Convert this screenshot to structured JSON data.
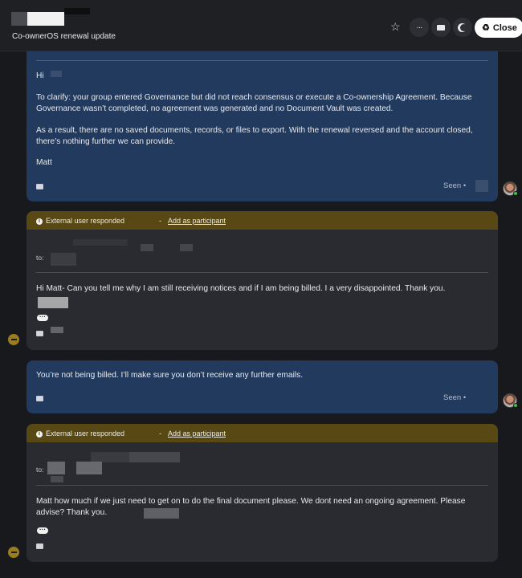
{
  "header": {
    "title": "Co-ownerOS renewal update",
    "close_label": "Close",
    "more_glyph": "···"
  },
  "messages": [
    {
      "greeting": "Hi",
      "paragraph1": "To clarify: your group entered Governance but did not reach consensus or execute a Co-ownership Agreement. Because Governance wasn’t completed, no agreement was generated and no Document Vault was created.",
      "paragraph2": "As a result, there are no saved documents, records, or files to export. With the renewal reversed and the account closed, there’s nothing further we can provide.",
      "signoff": "Matt",
      "seen_label": "Seen •"
    },
    {
      "banner_text": "External user responded",
      "banner_sep": "-",
      "banner_link": "Add as participant",
      "to_label": "to:",
      "body": "Hi Matt- Can you tell me why I am still receiving notices and if I am being billed. I a very disappointed. Thank you."
    },
    {
      "body": "You’re not being billed. I’ll make sure you don’t receive any further emails.",
      "seen_label": "Seen •"
    },
    {
      "banner_text": "External user responded",
      "banner_sep": "-",
      "banner_link": "Add as participant",
      "to_label": "to:",
      "body": "Matt how much if we just need to get on to do the final document please. We dont need an ongoing agreement. Please advise? Thank you."
    }
  ],
  "icons": {
    "star": "☆",
    "info": "i",
    "recycle": "♻"
  }
}
